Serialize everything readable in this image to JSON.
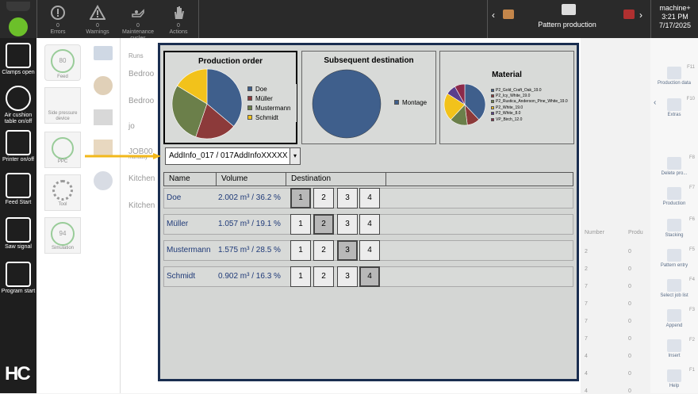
{
  "topbar": {
    "errors": {
      "count": "0",
      "label": "Errors"
    },
    "warnings": {
      "count": "0",
      "label": "Warnings"
    },
    "maintenance": {
      "count": "0",
      "label": "Maintenance cycles"
    },
    "actions": {
      "count": "0",
      "label": "Actions"
    },
    "mode_label": "Pattern production",
    "user": "machine+",
    "time": "3:21 PM",
    "date": "7/17/2025"
  },
  "leftbar": {
    "items": [
      {
        "label": "Clamps open",
        "icon": "clamps-icon"
      },
      {
        "label": "Air cushion table on/off",
        "icon": "air-cushion-icon"
      },
      {
        "label": "Printer on/off",
        "icon": "printer-icon"
      },
      {
        "label": "Feed Start",
        "icon": "feed-start-icon"
      },
      {
        "label": "Saw signal",
        "icon": "saw-signal-icon"
      },
      {
        "label": "Program start",
        "icon": "program-start-icon"
      }
    ],
    "logo": "HC"
  },
  "panel": {
    "feed": {
      "value": "80",
      "label": "Feed"
    },
    "side_pressure": {
      "label": "Side pressure device"
    },
    "ppc": {
      "label": "PPC"
    },
    "tool": {
      "label": "Tool"
    },
    "simulation": {
      "value": "94",
      "label": "Simulation"
    }
  },
  "background_list": {
    "header": "Runs",
    "rows": [
      "Bedroo",
      "Bedroo",
      "jo",
      "JOB00",
      "Kitchen",
      "Kitchen"
    ],
    "manually": "manually",
    "number_header": "Number",
    "prod_header": "Produ",
    "numbers": [
      [
        "2",
        "0"
      ],
      [
        "2",
        "0"
      ],
      [
        "7",
        "0"
      ],
      [
        "7",
        "0"
      ],
      [
        "7",
        "0"
      ],
      [
        "7",
        "0"
      ],
      [
        "4",
        "0"
      ],
      [
        "4",
        "0"
      ],
      [
        "4",
        "0"
      ]
    ]
  },
  "rightcol": {
    "items": [
      {
        "key": "F11",
        "label": "Production data"
      },
      {
        "key": "F10",
        "label": "Extras"
      },
      {
        "key": "F8",
        "label": "Delete pro..."
      },
      {
        "key": "F7",
        "label": "Production"
      },
      {
        "key": "F6",
        "label": "Stacking"
      },
      {
        "key": "F5",
        "label": "Pattern entry"
      },
      {
        "key": "F4",
        "label": "Select job list"
      },
      {
        "key": "F3",
        "label": "Append"
      },
      {
        "key": "F2",
        "label": "Insert"
      },
      {
        "key": "F1",
        "label": "Help"
      }
    ]
  },
  "modal": {
    "production_order": {
      "title": "Production order",
      "legend": [
        {
          "name": "Doe",
          "color": "#3f5f8c"
        },
        {
          "name": "Müller",
          "color": "#8c3a3a"
        },
        {
          "name": "Mustermann",
          "color": "#6b7f4a"
        },
        {
          "name": "Schmidt",
          "color": "#f2c21b"
        }
      ]
    },
    "subsequent_destination": {
      "title": "Subsequent destination",
      "legend": [
        {
          "name": "Montage",
          "color": "#3f5f8c"
        }
      ]
    },
    "material": {
      "title": "Material",
      "legend": [
        {
          "name": "P2_Gold_Craft_Oak_19.0",
          "color": "#3f5f8c"
        },
        {
          "name": "P2_Icy_White_19.0",
          "color": "#8c3a3a"
        },
        {
          "name": "P2_Rustica_Anderson_Pine_White_19.0",
          "color": "#6b7f4a"
        },
        {
          "name": "P2_White_19.0",
          "color": "#f2c21b"
        },
        {
          "name": "P2_White_8.0",
          "color": "#5a3f8c"
        },
        {
          "name": "VP_Birch_12.0",
          "color": "#8c2a4a"
        }
      ]
    },
    "dropdown_value": "AddInfo_017 / 017AddInfoXXXXX",
    "dropdown_arrow": "▾",
    "columns": {
      "name": "Name",
      "volume": "Volume",
      "destination": "Destination"
    },
    "rows": [
      {
        "name": "Doe",
        "volume": "2.002 m³ / 36.2 %",
        "selected": 1
      },
      {
        "name": "Müller",
        "volume": "1.057 m³ / 19.1 %",
        "selected": 2
      },
      {
        "name": "Mustermann",
        "volume": "1.575 m³ / 28.5 %",
        "selected": 3
      },
      {
        "name": "Schmidt",
        "volume": "0.902 m³ / 16.3 %",
        "selected": 4
      }
    ],
    "dest_labels": [
      "1",
      "2",
      "3",
      "4"
    ]
  },
  "chart_data": [
    {
      "type": "pie",
      "title": "Production order",
      "categories": [
        "Doe",
        "Müller",
        "Mustermann",
        "Schmidt"
      ],
      "values": [
        36.2,
        19.1,
        28.5,
        16.3
      ],
      "legend": "right"
    },
    {
      "type": "pie",
      "title": "Subsequent destination",
      "categories": [
        "Montage"
      ],
      "values": [
        100
      ],
      "legend": "right"
    },
    {
      "type": "pie",
      "title": "Material",
      "categories": [
        "P2_Gold_Craft_Oak_19.0",
        "P2_Icy_White_19.0",
        "P2_Rustica_Anderson_Pine_White_19.0",
        "P2_White_19.0",
        "P2_White_8.0",
        "VP_Birch_12.0"
      ],
      "values": [
        38,
        10,
        14,
        22,
        8,
        8
      ],
      "legend": "right"
    }
  ]
}
